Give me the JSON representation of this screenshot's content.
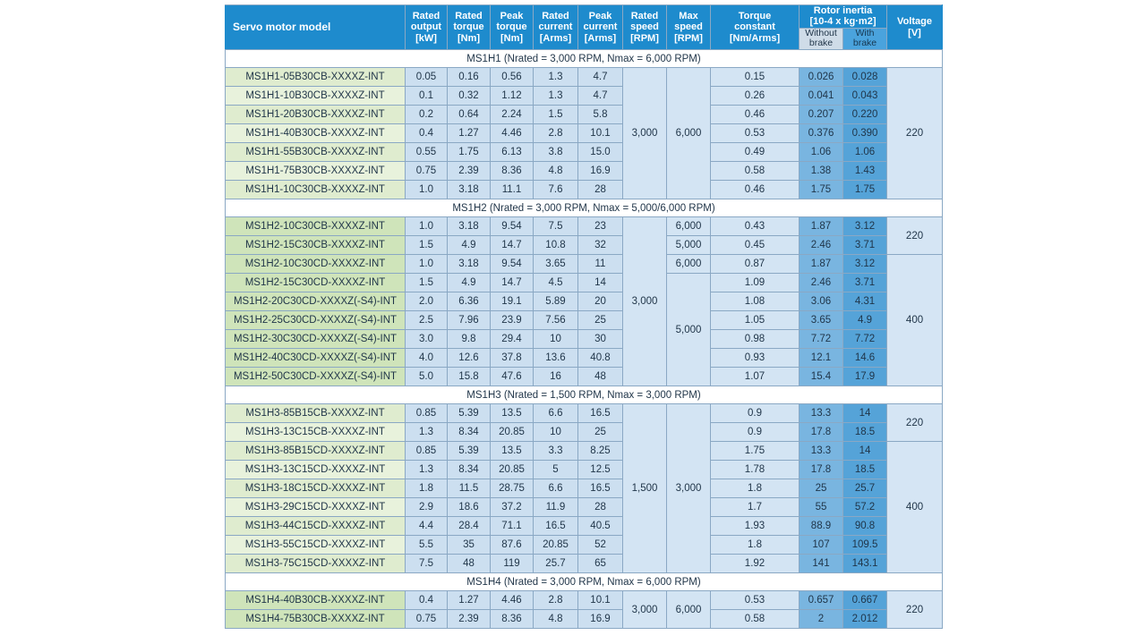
{
  "table": {
    "headers": {
      "model": "Servo motor model",
      "rated_output": "Rated\noutput\n[kW]",
      "rated_output_l1": "Rated",
      "rated_output_l2": "output",
      "rated_output_l3": "[kW]",
      "rated_torque_l1": "Rated",
      "rated_torque_l2": "torque",
      "rated_torque_l3": "[Nm]",
      "peak_torque_l1": "Peak",
      "peak_torque_l2": "torque",
      "peak_torque_l3": "[Nm]",
      "rated_current_l1": "Rated",
      "rated_current_l2": "current",
      "rated_current_l3": "[Arms]",
      "peak_current_l1": "Peak",
      "peak_current_l2": "current",
      "peak_current_l3": "[Arms]",
      "rated_speed_l1": "Rated",
      "rated_speed_l2": "speed",
      "rated_speed_l3": "[RPM]",
      "max_speed_l1": "Max",
      "max_speed_l2": "speed",
      "max_speed_l3": "[RPM]",
      "torque_constant_l1": "Torque",
      "torque_constant_l2": "constant",
      "torque_constant_l3": "[Nm/Arms]",
      "rotor_inertia_l1": "Rotor inertia",
      "rotor_inertia_l2": "[10-4 x kg·m2]",
      "without_brake_l1": "Without",
      "without_brake_l2": "brake",
      "with_brake_l1": "With",
      "with_brake_l2": "brake",
      "voltage_l1": "Voltage",
      "voltage_l2": "[V]"
    },
    "groups": [
      {
        "label": "MS1H1 (Nrated = 3,000 RPM, Nmax = 6,000 RPM)",
        "rows": [
          {
            "model": "MS1H1-05B30CB-XXXXZ-INT",
            "rated_output": "0.05",
            "rated_torque": "0.16",
            "peak_torque": "0.56",
            "rated_current": "1.3",
            "peak_current": "4.7",
            "torque_constant": "0.15",
            "inertia_without": "0.026",
            "inertia_with": "0.028"
          },
          {
            "model": "MS1H1-10B30CB-XXXXZ-INT",
            "rated_output": "0.1",
            "rated_torque": "0.32",
            "peak_torque": "1.12",
            "rated_current": "1.3",
            "peak_current": "4.7",
            "torque_constant": "0.26",
            "inertia_without": "0.041",
            "inertia_with": "0.043"
          },
          {
            "model": "MS1H1-20B30CB-XXXXZ-INT",
            "rated_output": "0.2",
            "rated_torque": "0.64",
            "peak_torque": "2.24",
            "rated_current": "1.5",
            "peak_current": "5.8",
            "torque_constant": "0.46",
            "inertia_without": "0.207",
            "inertia_with": "0.220"
          },
          {
            "model": "MS1H1-40B30CB-XXXXZ-INT",
            "rated_output": "0.4",
            "rated_torque": "1.27",
            "peak_torque": "4.46",
            "rated_current": "2.8",
            "peak_current": "10.1",
            "torque_constant": "0.53",
            "inertia_without": "0.376",
            "inertia_with": "0.390"
          },
          {
            "model": "MS1H1-55B30CB-XXXXZ-INT",
            "rated_output": "0.55",
            "rated_torque": "1.75",
            "peak_torque": "6.13",
            "rated_current": "3.8",
            "peak_current": "15.0",
            "torque_constant": "0.49",
            "inertia_without": "1.06",
            "inertia_with": "1.06"
          },
          {
            "model": "MS1H1-75B30CB-XXXXZ-INT",
            "rated_output": "0.75",
            "rated_torque": "2.39",
            "peak_torque": "8.36",
            "rated_current": "4.8",
            "peak_current": "16.9",
            "torque_constant": "0.58",
            "inertia_without": "1.38",
            "inertia_with": "1.43"
          },
          {
            "model": "MS1H1-10C30CB-XXXXZ-INT",
            "rated_output": "1.0",
            "rated_torque": "3.18",
            "peak_torque": "11.1",
            "rated_current": "7.6",
            "peak_current": "28",
            "torque_constant": "0.46",
            "inertia_without": "1.75",
            "inertia_with": "1.75"
          }
        ],
        "rated_speed_spans": [
          {
            "value": "3,000",
            "rows": 7
          }
        ],
        "max_speed_spans": [
          {
            "value": "6,000",
            "rows": 7
          }
        ],
        "voltage_spans": [
          {
            "value": "220",
            "rows": 7
          }
        ]
      },
      {
        "label": "MS1H2 (Nrated = 3,000 RPM, Nmax = 5,000/6,000 RPM)",
        "rows": [
          {
            "model": "MS1H2-10C30CB-XXXXZ-INT",
            "rated_output": "1.0",
            "rated_torque": "3.18",
            "peak_torque": "9.54",
            "rated_current": "7.5",
            "peak_current": "23",
            "torque_constant": "0.43",
            "inertia_without": "1.87",
            "inertia_with": "3.12"
          },
          {
            "model": "MS1H2-15C30CB-XXXXZ-INT",
            "rated_output": "1.5",
            "rated_torque": "4.9",
            "peak_torque": "14.7",
            "rated_current": "10.8",
            "peak_current": "32",
            "torque_constant": "0.45",
            "inertia_without": "2.46",
            "inertia_with": "3.71"
          },
          {
            "model": "MS1H2-10C30CD-XXXXZ-INT",
            "rated_output": "1.0",
            "rated_torque": "3.18",
            "peak_torque": "9.54",
            "rated_current": "3.65",
            "peak_current": "11",
            "torque_constant": "0.87",
            "inertia_without": "1.87",
            "inertia_with": "3.12"
          },
          {
            "model": "MS1H2-15C30CD-XXXXZ-INT",
            "rated_output": "1.5",
            "rated_torque": "4.9",
            "peak_torque": "14.7",
            "rated_current": "4.5",
            "peak_current": "14",
            "torque_constant": "1.09",
            "inertia_without": "2.46",
            "inertia_with": "3.71"
          },
          {
            "model": "MS1H2-20C30CD-XXXXZ(-S4)-INT",
            "rated_output": "2.0",
            "rated_torque": "6.36",
            "peak_torque": "19.1",
            "rated_current": "5.89",
            "peak_current": "20",
            "torque_constant": "1.08",
            "inertia_without": "3.06",
            "inertia_with": "4.31"
          },
          {
            "model": "MS1H2-25C30CD-XXXXZ(-S4)-INT",
            "rated_output": "2.5",
            "rated_torque": "7.96",
            "peak_torque": "23.9",
            "rated_current": "7.56",
            "peak_current": "25",
            "torque_constant": "1.05",
            "inertia_without": "3.65",
            "inertia_with": "4.9"
          },
          {
            "model": "MS1H2-30C30CD-XXXXZ(-S4)-INT",
            "rated_output": "3.0",
            "rated_torque": "9.8",
            "peak_torque": "29.4",
            "rated_current": "10",
            "peak_current": "30",
            "torque_constant": "0.98",
            "inertia_without": "7.72",
            "inertia_with": "7.72"
          },
          {
            "model": "MS1H2-40C30CD-XXXXZ(-S4)-INT",
            "rated_output": "4.0",
            "rated_torque": "12.6",
            "peak_torque": "37.8",
            "rated_current": "13.6",
            "peak_current": "40.8",
            "torque_constant": "0.93",
            "inertia_without": "12.1",
            "inertia_with": "14.6"
          },
          {
            "model": "MS1H2-50C30CD-XXXXZ(-S4)-INT",
            "rated_output": "5.0",
            "rated_torque": "15.8",
            "peak_torque": "47.6",
            "rated_current": "16",
            "peak_current": "48",
            "torque_constant": "1.07",
            "inertia_without": "15.4",
            "inertia_with": "17.9"
          }
        ],
        "rated_speed_spans": [
          {
            "value": "3,000",
            "rows": 9
          }
        ],
        "max_speed_spans": [
          {
            "value": "6,000",
            "rows": 1
          },
          {
            "value": "5,000",
            "rows": 1
          },
          {
            "value": "6,000",
            "rows": 1
          },
          {
            "value": "5,000",
            "rows": 6
          }
        ],
        "voltage_spans": [
          {
            "value": "220",
            "rows": 2
          },
          {
            "value": "400",
            "rows": 7
          }
        ]
      },
      {
        "label": "MS1H3 (Nrated = 1,500 RPM, Nmax = 3,000 RPM)",
        "rows": [
          {
            "model": "MS1H3-85B15CB-XXXXZ-INT",
            "rated_output": "0.85",
            "rated_torque": "5.39",
            "peak_torque": "13.5",
            "rated_current": "6.6",
            "peak_current": "16.5",
            "torque_constant": "0.9",
            "inertia_without": "13.3",
            "inertia_with": "14"
          },
          {
            "model": "MS1H3-13C15CB-XXXXZ-INT",
            "rated_output": "1.3",
            "rated_torque": "8.34",
            "peak_torque": "20.85",
            "rated_current": "10",
            "peak_current": "25",
            "torque_constant": "0.9",
            "inertia_without": "17.8",
            "inertia_with": "18.5"
          },
          {
            "model": "MS1H3-85B15CD-XXXXZ-INT",
            "rated_output": "0.85",
            "rated_torque": "5.39",
            "peak_torque": "13.5",
            "rated_current": "3.3",
            "peak_current": "8.25",
            "torque_constant": "1.75",
            "inertia_without": "13.3",
            "inertia_with": "14"
          },
          {
            "model": "MS1H3-13C15CD-XXXXZ-INT",
            "rated_output": "1.3",
            "rated_torque": "8.34",
            "peak_torque": "20.85",
            "rated_current": "5",
            "peak_current": "12.5",
            "torque_constant": "1.78",
            "inertia_without": "17.8",
            "inertia_with": "18.5"
          },
          {
            "model": "MS1H3-18C15CD-XXXXZ-INT",
            "rated_output": "1.8",
            "rated_torque": "11.5",
            "peak_torque": "28.75",
            "rated_current": "6.6",
            "peak_current": "16.5",
            "torque_constant": "1.8",
            "inertia_without": "25",
            "inertia_with": "25.7"
          },
          {
            "model": "MS1H3-29C15CD-XXXXZ-INT",
            "rated_output": "2.9",
            "rated_torque": "18.6",
            "peak_torque": "37.2",
            "rated_current": "11.9",
            "peak_current": "28",
            "torque_constant": "1.7",
            "inertia_without": "55",
            "inertia_with": "57.2"
          },
          {
            "model": "MS1H3-44C15CD-XXXXZ-INT",
            "rated_output": "4.4",
            "rated_torque": "28.4",
            "peak_torque": "71.1",
            "rated_current": "16.5",
            "peak_current": "40.5",
            "torque_constant": "1.93",
            "inertia_without": "88.9",
            "inertia_with": "90.8"
          },
          {
            "model": "MS1H3-55C15CD-XXXXZ-INT",
            "rated_output": "5.5",
            "rated_torque": "35",
            "peak_torque": "87.6",
            "rated_current": "20.85",
            "peak_current": "52",
            "torque_constant": "1.8",
            "inertia_without": "107",
            "inertia_with": "109.5"
          },
          {
            "model": "MS1H3-75C15CD-XXXXZ-INT",
            "rated_output": "7.5",
            "rated_torque": "48",
            "peak_torque": "119",
            "rated_current": "25.7",
            "peak_current": "65",
            "torque_constant": "1.92",
            "inertia_without": "141",
            "inertia_with": "143.1"
          }
        ],
        "rated_speed_spans": [
          {
            "value": "1,500",
            "rows": 9
          }
        ],
        "max_speed_spans": [
          {
            "value": "3,000",
            "rows": 9
          }
        ],
        "voltage_spans": [
          {
            "value": "220",
            "rows": 2
          },
          {
            "value": "400",
            "rows": 7
          }
        ]
      },
      {
        "label": "MS1H4 (Nrated = 3,000 RPM, Nmax = 6,000 RPM)",
        "rows": [
          {
            "model": "MS1H4-40B30CB-XXXXZ-INT",
            "rated_output": "0.4",
            "rated_torque": "1.27",
            "peak_torque": "4.46",
            "rated_current": "2.8",
            "peak_current": "10.1",
            "torque_constant": "0.53",
            "inertia_without": "0.657",
            "inertia_with": "0.667"
          },
          {
            "model": "MS1H4-75B30CB-XXXXZ-INT",
            "rated_output": "0.75",
            "rated_torque": "2.39",
            "peak_torque": "8.36",
            "rated_current": "4.8",
            "peak_current": "16.9",
            "torque_constant": "0.58",
            "inertia_without": "2",
            "inertia_with": "2.012"
          }
        ],
        "rated_speed_spans": [
          {
            "value": "3,000",
            "rows": 2
          }
        ],
        "max_speed_spans": [
          {
            "value": "6,000",
            "rows": 2
          }
        ],
        "voltage_spans": [
          {
            "value": "220",
            "rows": 2
          }
        ]
      }
    ]
  },
  "colors": {
    "header_blue": "#1e8bcd",
    "model_green": "#dfeccf",
    "model_green_strong": "#cfe4ba",
    "data_blue": "#ccdff0",
    "inertia_without": "#79b5e0",
    "inertia_with": "#55a3d8"
  }
}
